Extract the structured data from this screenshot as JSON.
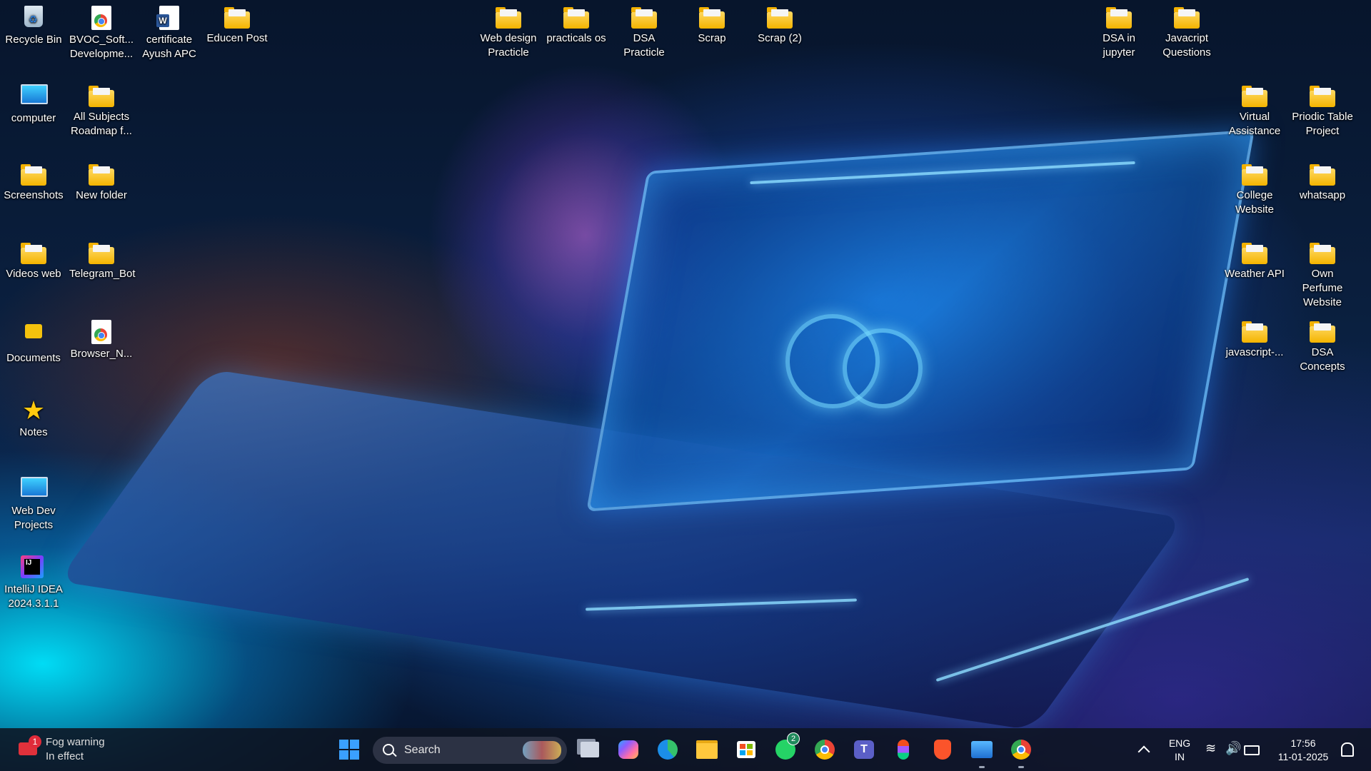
{
  "desktop": {
    "left_column_1": [
      {
        "label": "Recycle Bin",
        "icon": "recycle-bin-icon"
      },
      {
        "label": "computer",
        "icon": "computer-icon"
      },
      {
        "label": "Screenshots",
        "icon": "folder-icon"
      },
      {
        "label": "Videos web",
        "icon": "folder-icon"
      },
      {
        "label": "Documents",
        "icon": "lock-icon"
      },
      {
        "label": "Notes",
        "icon": "star-icon"
      },
      {
        "label": "Web Dev Projects",
        "icon": "computer-icon"
      },
      {
        "label": "IntelliJ IDEA 2024.3.1.1",
        "icon": "intellij-icon"
      }
    ],
    "left_column_2": [
      {
        "label": "BVOC_Soft... Developme...",
        "icon": "chrome-file-icon"
      },
      {
        "label": "All Subjects Roadmap f...",
        "icon": "folder-icon"
      },
      {
        "label": "New folder",
        "icon": "folder-icon"
      },
      {
        "label": "Telegram_Bot",
        "icon": "folder-icon"
      },
      {
        "label": "Browser_N...",
        "icon": "chrome-file-icon"
      }
    ],
    "left_column_3": [
      {
        "label": "certificate Ayush APC",
        "icon": "word-file-icon"
      }
    ],
    "left_column_4": [
      {
        "label": "Educen Post",
        "icon": "folder-icon"
      }
    ],
    "top_row": [
      {
        "label": "Web design Practicle",
        "icon": "folder-icon"
      },
      {
        "label": "practicals os",
        "icon": "folder-icon"
      },
      {
        "label": "DSA Practicle",
        "icon": "folder-icon"
      },
      {
        "label": "Scrap",
        "icon": "folder-icon"
      },
      {
        "label": "Scrap (2)",
        "icon": "folder-icon"
      }
    ],
    "right_top": [
      {
        "label": "DSA in jupyter",
        "icon": "folder-icon"
      },
      {
        "label": "Javacript Questions",
        "icon": "folder-icon"
      }
    ],
    "right_column_1": [
      {
        "label": "Virtual Assistance",
        "icon": "folder-icon"
      },
      {
        "label": "College Website",
        "icon": "folder-icon"
      },
      {
        "label": "Weather API",
        "icon": "folder-icon"
      },
      {
        "label": "javascript-...",
        "icon": "folder-icon"
      }
    ],
    "right_column_2": [
      {
        "label": "Priodic Table Project",
        "icon": "folder-icon"
      },
      {
        "label": "whatsapp",
        "icon": "folder-icon"
      },
      {
        "label": "Own Perfume Website",
        "icon": "folder-icon"
      },
      {
        "label": "DSA Concepts",
        "icon": "folder-icon"
      }
    ]
  },
  "taskbar": {
    "weather": {
      "title": "Fog warning",
      "subtitle": "In effect",
      "badge": "1"
    },
    "search": {
      "label": "Search"
    },
    "whatsapp_badge": "2",
    "language": {
      "line1": "ENG",
      "line2": "IN"
    },
    "clock": {
      "time": "17:56",
      "date": "11-01-2025"
    }
  },
  "colors": {
    "folder": "#f4b400",
    "accent": "#3aa0ff",
    "taskbar": "#0e1422"
  }
}
